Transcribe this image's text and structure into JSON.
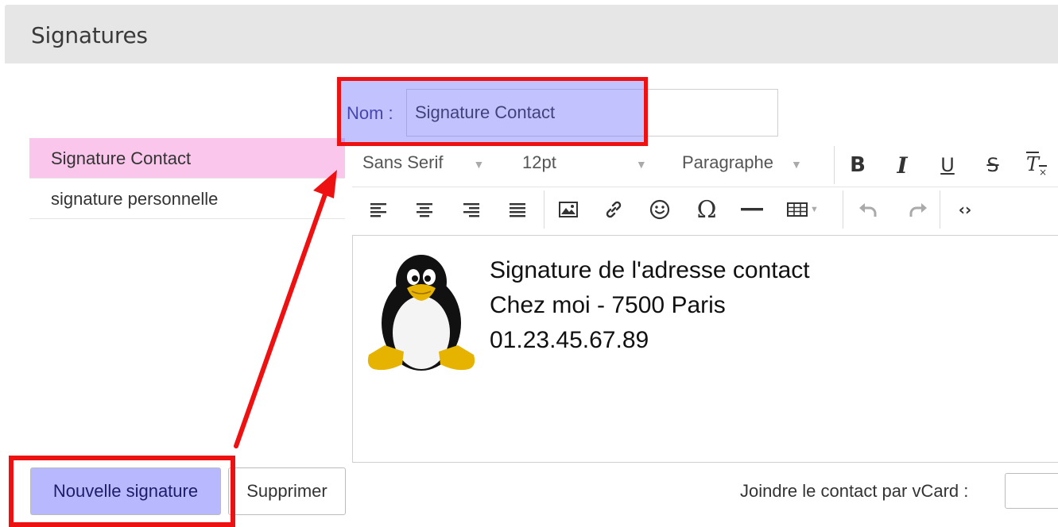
{
  "header": {
    "title": "Signatures"
  },
  "signature_list": [
    {
      "label": "Signature Contact",
      "selected": true
    },
    {
      "label": "signature personnelle",
      "selected": false
    }
  ],
  "name_field": {
    "label": "Nom :",
    "value": "Signature Contact"
  },
  "toolbar": {
    "font_family": "Sans Serif",
    "font_size": "12pt",
    "block_format": "Paragraphe",
    "buttons_row1": [
      "bold-icon",
      "italic-icon",
      "underline-icon",
      "strikethrough-icon",
      "clear-format-icon"
    ],
    "buttons_row2": [
      "align-left-icon",
      "align-center-icon",
      "align-right-icon",
      "align-justify-icon",
      "image-icon",
      "link-icon",
      "emoji-icon",
      "special-char-icon",
      "horizontal-rule-icon",
      "table-icon",
      "undo-icon",
      "redo-icon",
      "source-code-icon"
    ]
  },
  "editor": {
    "lines": [
      "Signature de l'adresse contact",
      "Chez moi - 7500 Paris",
      "01.23.45.67.89"
    ],
    "image": "tux-penguin"
  },
  "buttons": {
    "new": "Nouvelle signature",
    "delete": "Supprimer"
  },
  "vcard": {
    "label": "Joindre le contact par vCard :"
  },
  "colors": {
    "header_bg": "#e6e6e6",
    "selected_item_bg": "#fbc6eb",
    "highlight_fill": "#b8b8ff",
    "annotation_red": "#ee1111"
  }
}
